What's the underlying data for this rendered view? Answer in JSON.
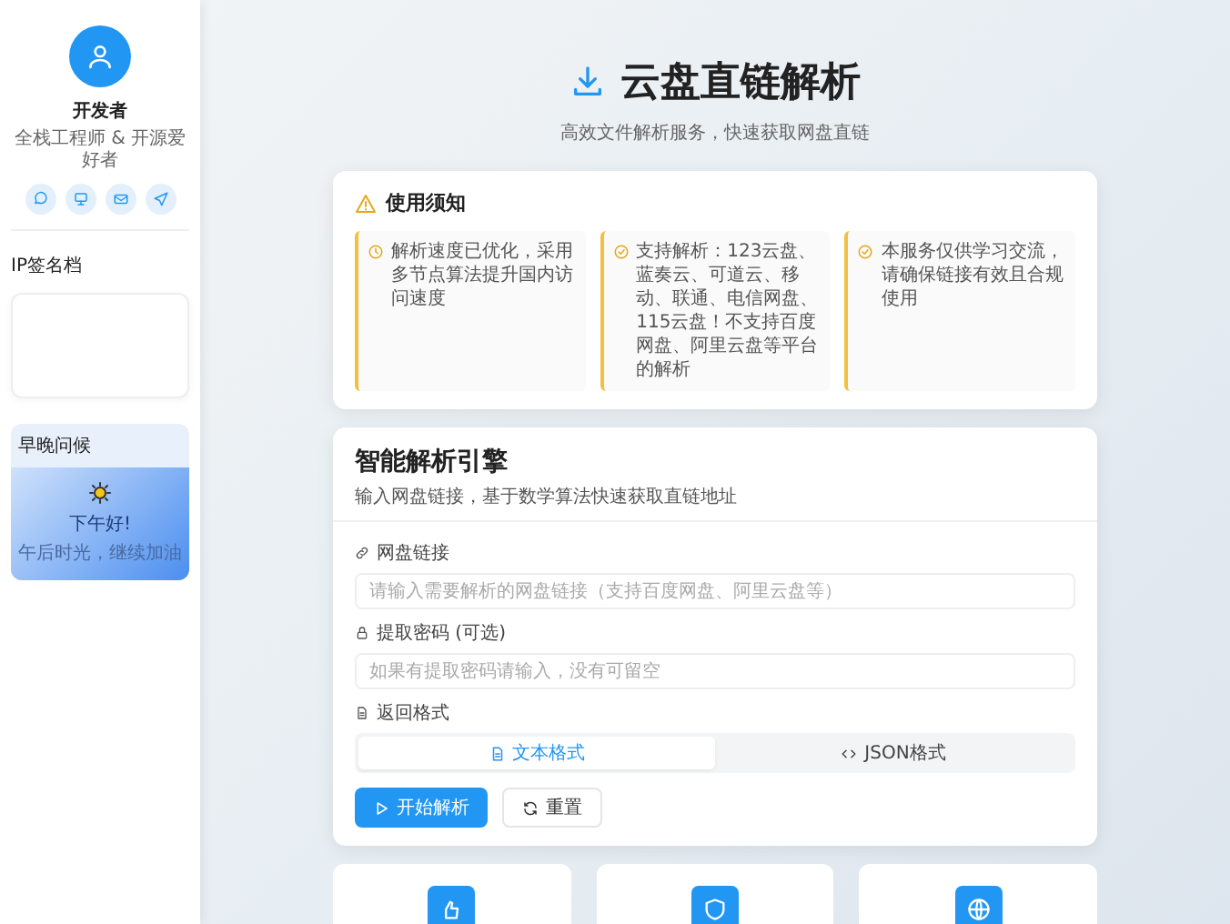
{
  "sidebar": {
    "profile": {
      "name": "开发者",
      "subtitle": "全栈工程师 & 开源爱好者"
    },
    "social": [
      {
        "kind": "chat"
      },
      {
        "kind": "monitor"
      },
      {
        "kind": "mail"
      },
      {
        "kind": "send"
      }
    ],
    "signature": {
      "title": "IP签名档"
    },
    "greeting": {
      "title": "早晚问候",
      "headline": "下午好!",
      "message": "午后时光，继续加油"
    }
  },
  "header": {
    "title": "云盘直链解析",
    "subtitle": "高效文件解析服务，快速获取网盘直链"
  },
  "notice": {
    "title": "使用须知",
    "items": [
      {
        "kind": "clock",
        "text": "解析速度已优化，采用多节点算法提升国内访问速度"
      },
      {
        "kind": "check",
        "text": "支持解析：123云盘、蓝奏云、可道云、移动、联通、电信网盘、115云盘！不支持百度网盘、阿里云盘等平台的解析"
      },
      {
        "kind": "check",
        "text": "本服务仅供学习交流，请确保链接有效且合规使用"
      }
    ]
  },
  "parser": {
    "title": "智能解析引擎",
    "subtitle": "输入网盘链接，基于数学算法快速获取直链地址",
    "fields": [
      {
        "kind": "link",
        "label": "网盘链接",
        "placeholder": "请输入需要解析的网盘链接（支持百度网盘、阿里云盘等）"
      },
      {
        "kind": "lock",
        "label": "提取密码 (可选)",
        "placeholder": "如果有提取密码请输入，没有可留空"
      }
    ],
    "format": {
      "label": "返回格式",
      "options": [
        {
          "kind": "file",
          "label": "文本格式",
          "selected": true
        },
        {
          "kind": "code",
          "label": "JSON格式",
          "selected": false
        }
      ]
    },
    "buttons": [
      {
        "kind": "primary",
        "label": "开始解析"
      },
      {
        "kind": "secondary",
        "label": "重置"
      }
    ]
  },
  "features": [
    {
      "kind": "hand"
    },
    {
      "kind": "shield"
    },
    {
      "kind": "globe"
    }
  ]
}
